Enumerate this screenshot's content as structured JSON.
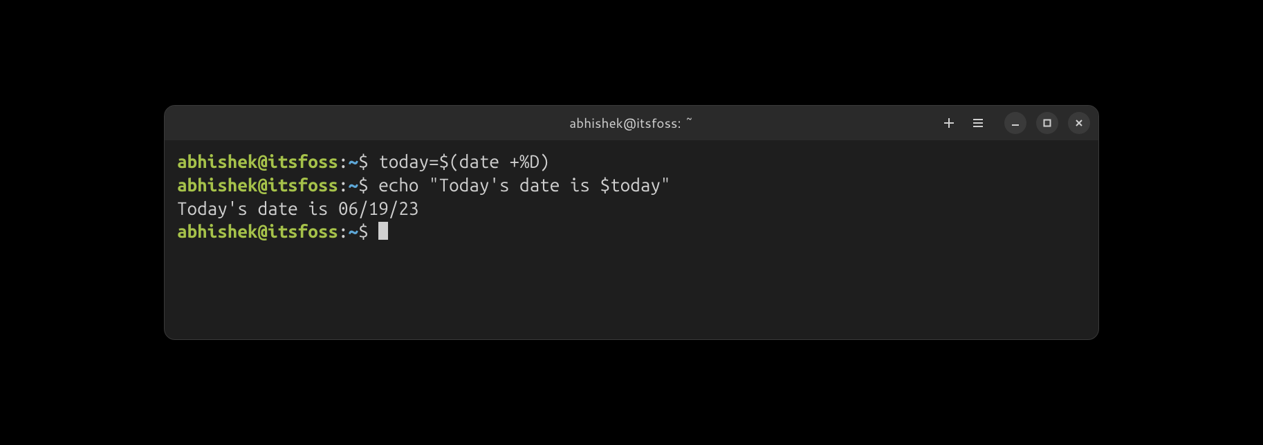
{
  "titlebar": {
    "title": "abhishek@itsfoss: ~"
  },
  "colors": {
    "prompt_user": "#a6c24a",
    "prompt_path": "#5ea8d8",
    "fg": "#d0d0d0",
    "bg": "#1e1e1e",
    "titlebar_bg": "#2a2a2a"
  },
  "terminal": {
    "lines": [
      {
        "type": "prompt",
        "user": "abhishek@itsfoss",
        "sep1": ":",
        "path": "~",
        "sep2": "$ ",
        "command": "today=$(date +%D)"
      },
      {
        "type": "prompt",
        "user": "abhishek@itsfoss",
        "sep1": ":",
        "path": "~",
        "sep2": "$ ",
        "command": "echo \"Today's date is $today\""
      },
      {
        "type": "output",
        "text": "Today's date is 06/19/23"
      },
      {
        "type": "prompt",
        "user": "abhishek@itsfoss",
        "sep1": ":",
        "path": "~",
        "sep2": "$ ",
        "command": "",
        "cursor": true
      }
    ]
  }
}
